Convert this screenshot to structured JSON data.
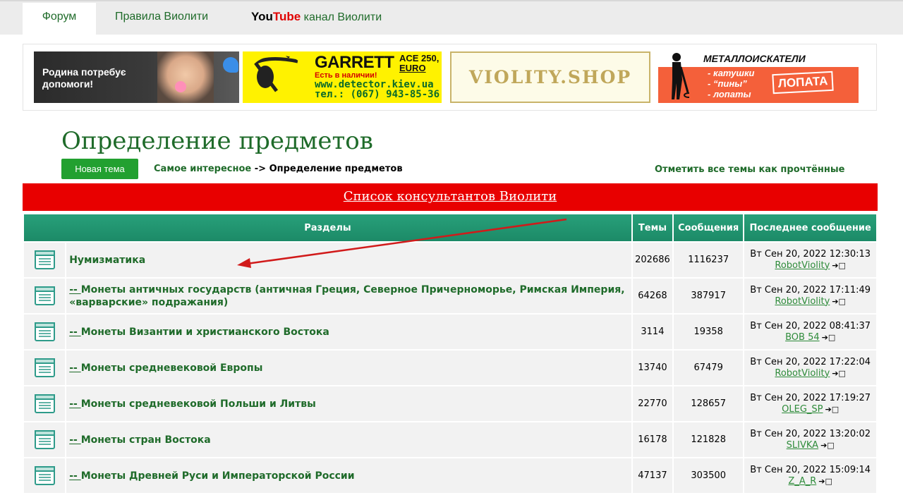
{
  "nav": {
    "forum": "Форум",
    "rules": "Правила Виолити",
    "yt_you": "You",
    "yt_tube": "Tube",
    "yt_rest": " канал Виолити"
  },
  "banners": {
    "help": {
      "line1": "Родина потребує",
      "line2": "допомоги!"
    },
    "garrett": {
      "brand": "GARRETT",
      "model1": "ACE 250,",
      "model2": "EURO",
      "stock": "Есть в наличии!",
      "site": "www.detector.kiev.ua",
      "phone": "тел.: (067) 943-85-36"
    },
    "shop": {
      "text": "VIOLITY.SHOP"
    },
    "lopata": {
      "title": "МЕТАЛЛОИСКАТЕЛИ",
      "item1": "- катушки",
      "item2": "- “пины”",
      "item3": "- лопаты",
      "brand": "ЛОПАТА"
    }
  },
  "page": {
    "title": "Определение предметов",
    "new_topic": "Новая тема",
    "breadcrumb_link": "Самое интересное",
    "breadcrumb_sep": " -> ",
    "breadcrumb_current": "Определение предметов",
    "mark_read": "Отметить все темы как прочтённые",
    "consultants": "Список консультантов Виолити"
  },
  "table": {
    "headers": {
      "sections": "Разделы",
      "topics": "Темы",
      "posts": "Сообщения",
      "last": "Последнее сообщение"
    },
    "rows": [
      {
        "prefix": "",
        "name": "Нумизматика",
        "topics": "202686",
        "posts": "1116237",
        "date": "Вт Сен 20, 2022 12:30:13",
        "user": "RobotViolity"
      },
      {
        "prefix": "-- ",
        "name": "Монеты античных государств (античная Греция, Северное Причерноморье, Римская Империя, «варварские» подражания)",
        "topics": "64268",
        "posts": "387917",
        "date": "Вт Сен 20, 2022 17:11:49",
        "user": "RobotViolity"
      },
      {
        "prefix": "-- ",
        "name": "Монеты Византии и христианского Востока",
        "topics": "3114",
        "posts": "19358",
        "date": "Вт Сен 20, 2022 08:41:37",
        "user": "BOB 54"
      },
      {
        "prefix": "-- ",
        "name": "Монеты средневековой Европы",
        "topics": "13740",
        "posts": "67479",
        "date": "Вт Сен 20, 2022 17:22:04",
        "user": "RobotViolity"
      },
      {
        "prefix": "-- ",
        "name": "Монеты средневековой Польши и Литвы",
        "topics": "22770",
        "posts": "128657",
        "date": "Вт Сен 20, 2022 17:19:27",
        "user": "OLEG_SP"
      },
      {
        "prefix": "-- ",
        "name": "Монеты стран Востока",
        "topics": "16178",
        "posts": "121828",
        "date": "Вт Сен 20, 2022 13:20:02",
        "user": "SLIVKA"
      },
      {
        "prefix": "-- ",
        "name": "Монеты Древней Руси и Императорской России",
        "topics": "47137",
        "posts": "303500",
        "date": "Вт Сен 20, 2022 15:09:14",
        "user": "Z_A_R"
      }
    ]
  },
  "colors": {
    "brand_green": "#1f6b2a",
    "header_green": "#1c8a67",
    "alert_red": "#e80000",
    "button_green": "#22a030"
  },
  "icons": {
    "forum": "forum-folder-icon",
    "goto": "goto-last-post-icon"
  }
}
